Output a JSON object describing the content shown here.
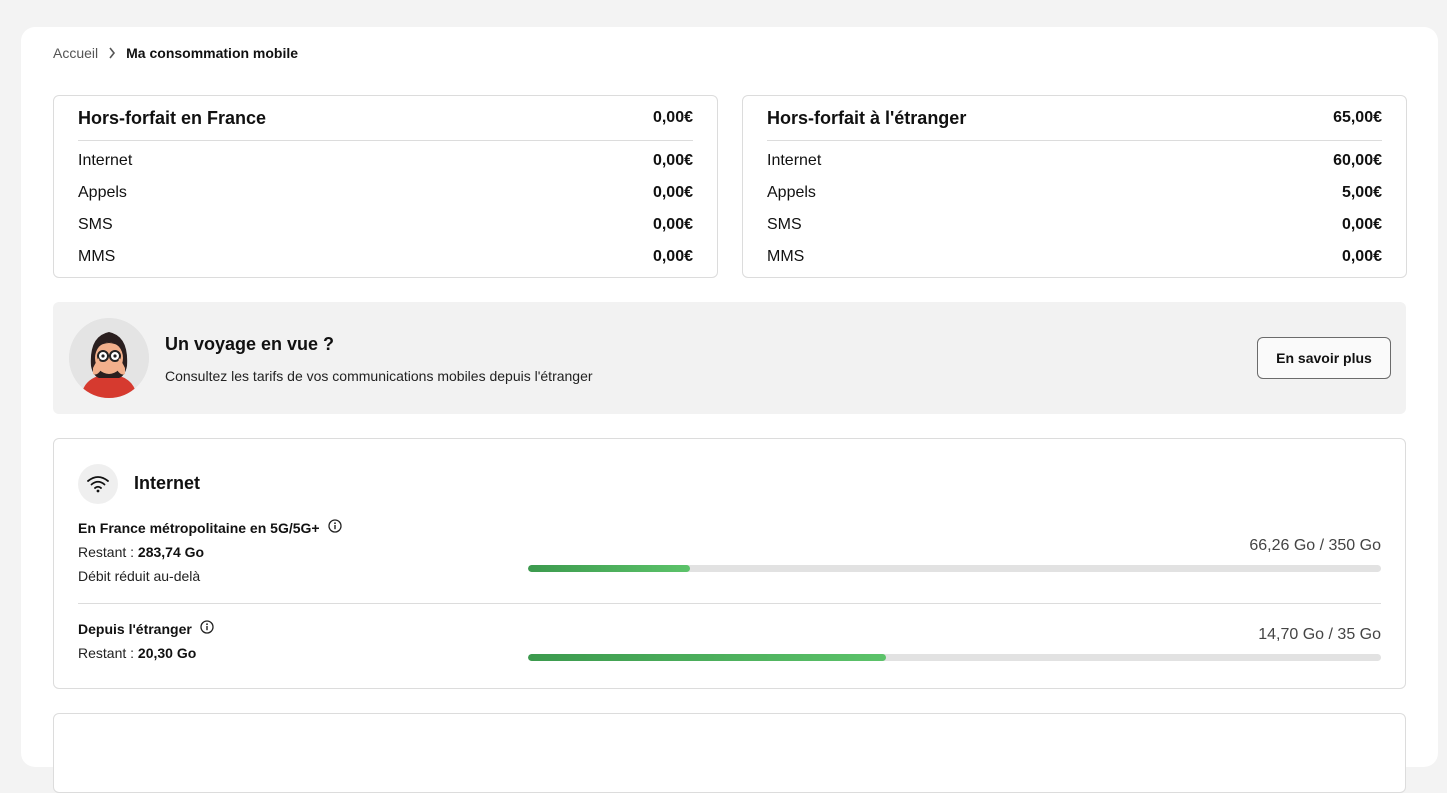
{
  "breadcrumb": {
    "home": "Accueil",
    "current": "Ma consommation mobile"
  },
  "france": {
    "title": "Hors-forfait en France",
    "total": "0,00€",
    "rows": [
      {
        "label": "Internet",
        "value": "0,00€"
      },
      {
        "label": "Appels",
        "value": "0,00€"
      },
      {
        "label": "SMS",
        "value": "0,00€"
      },
      {
        "label": "MMS",
        "value": "0,00€"
      }
    ]
  },
  "abroad": {
    "title": "Hors-forfait à l'étranger",
    "total": "65,00€",
    "rows": [
      {
        "label": "Internet",
        "value": "60,00€"
      },
      {
        "label": "Appels",
        "value": "5,00€"
      },
      {
        "label": "SMS",
        "value": "0,00€"
      },
      {
        "label": "MMS",
        "value": "0,00€"
      }
    ]
  },
  "promo": {
    "title": "Un voyage en vue ?",
    "description": "Consultez les tarifs de vos communications mobiles depuis l'étranger",
    "button_label": "En savoir plus"
  },
  "internet": {
    "title": "Internet",
    "icon": "wifi-icon",
    "usages": [
      {
        "label": "En France métropolitaine en 5G/5G+",
        "remaining_label": "Restant : ",
        "remaining_value": "283,74 Go",
        "note": "Débit réduit au-delà",
        "amount": "66,26 Go / 350 Go",
        "used_fraction": 0.19
      },
      {
        "label": "Depuis l'étranger",
        "remaining_label": "Restant : ",
        "remaining_value": "20,30 Go",
        "amount": "14,70 Go / 35 Go",
        "used_fraction": 0.42
      }
    ]
  },
  "colors": {
    "progress": "#4caf5a",
    "track": "#e2e2e2",
    "promo_bg": "#f2f2f2"
  }
}
